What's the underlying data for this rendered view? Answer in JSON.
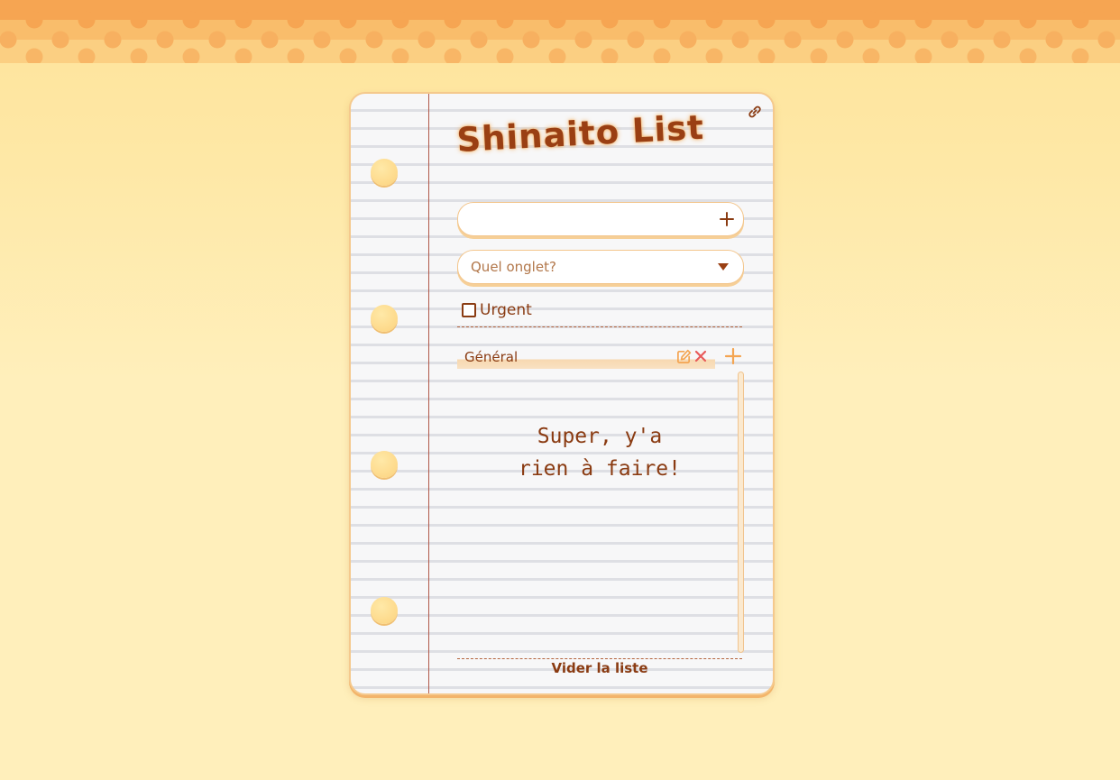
{
  "app": {
    "title": "Shinaito List"
  },
  "task_input": {
    "value": "",
    "placeholder": ""
  },
  "tab_select": {
    "placeholder": "Quel onglet?"
  },
  "urgent": {
    "label": "Urgent",
    "checked": false
  },
  "tabs": [
    {
      "label": "Général",
      "active": true
    }
  ],
  "empty_state": {
    "line1": "Super, y'a",
    "line2": "rien à faire!"
  },
  "footer": {
    "clear_label": "Vider la liste"
  },
  "icons": {
    "share": "link-icon",
    "add_task": "plus-icon",
    "select": "caret-down-icon",
    "edit_tab": "edit-icon",
    "delete_tab": "close-icon",
    "add_tab": "plus-icon"
  },
  "colors": {
    "text": "#8a3b12",
    "accent": "#f4a552",
    "delete": "#e85a5a",
    "background": "#ffefbb"
  }
}
